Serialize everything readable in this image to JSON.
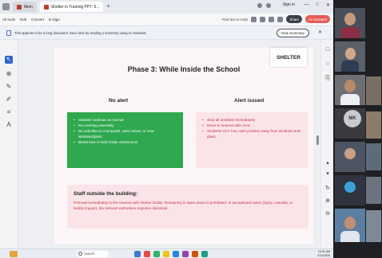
{
  "browser": {
    "tabs": [
      {
        "label": "Mein"
      },
      {
        "label": "Shelter in Training PPT: 5..."
      }
    ],
    "new_tab": "+",
    "sign_in": "Sign in",
    "window_controls": [
      "—",
      "□",
      "✕"
    ]
  },
  "pdf_toolbar": {
    "items": [
      "All tools",
      "Edit",
      "Convert",
      "E-Sign"
    ],
    "find_label": "Find text or tools",
    "share_label": "Share",
    "ai_label": "AI Assistant"
  },
  "infobar": {
    "message": "This appears to be a long document. Save time by reading a summary using AI Assistant.",
    "view_summary": "View Summary",
    "close": "✕"
  },
  "slide": {
    "title": "Phase 3: While Inside the School",
    "tag": "SHELTER",
    "no_alert": {
      "heading": "No alert",
      "items": [
        "Classes continue as normal",
        "No morning assembly",
        "No activities in courtyards, open areas, or near windows/glass",
        "Break time is held inside classrooms"
      ]
    },
    "alert_issued": {
      "heading": "Alert issued",
      "items": [
        "Stop all activities immediately",
        "Move to nearest safe zone",
        "Students sit in low, calm position away from windows and glass"
      ]
    },
    "staff": {
      "heading": "Staff outside the building:",
      "text": "Proceed immediately to the nearest safe interior facility. Remaining in open areas is prohibited. In exceptional cases (injury, casualty, or facility impact), the relevant authorities organise dismissal."
    }
  },
  "taskbar": {
    "search_placeholder": "Search",
    "time": "10:41 AM",
    "date": "2/11/2025"
  },
  "participants": {
    "avatar_initials": "MK"
  },
  "colors": {
    "no_alert_bg": "#2fa84f",
    "alert_bg": "#fbe4e8",
    "alert_text": "#c13344",
    "accent_blue": "#2d63d5"
  }
}
